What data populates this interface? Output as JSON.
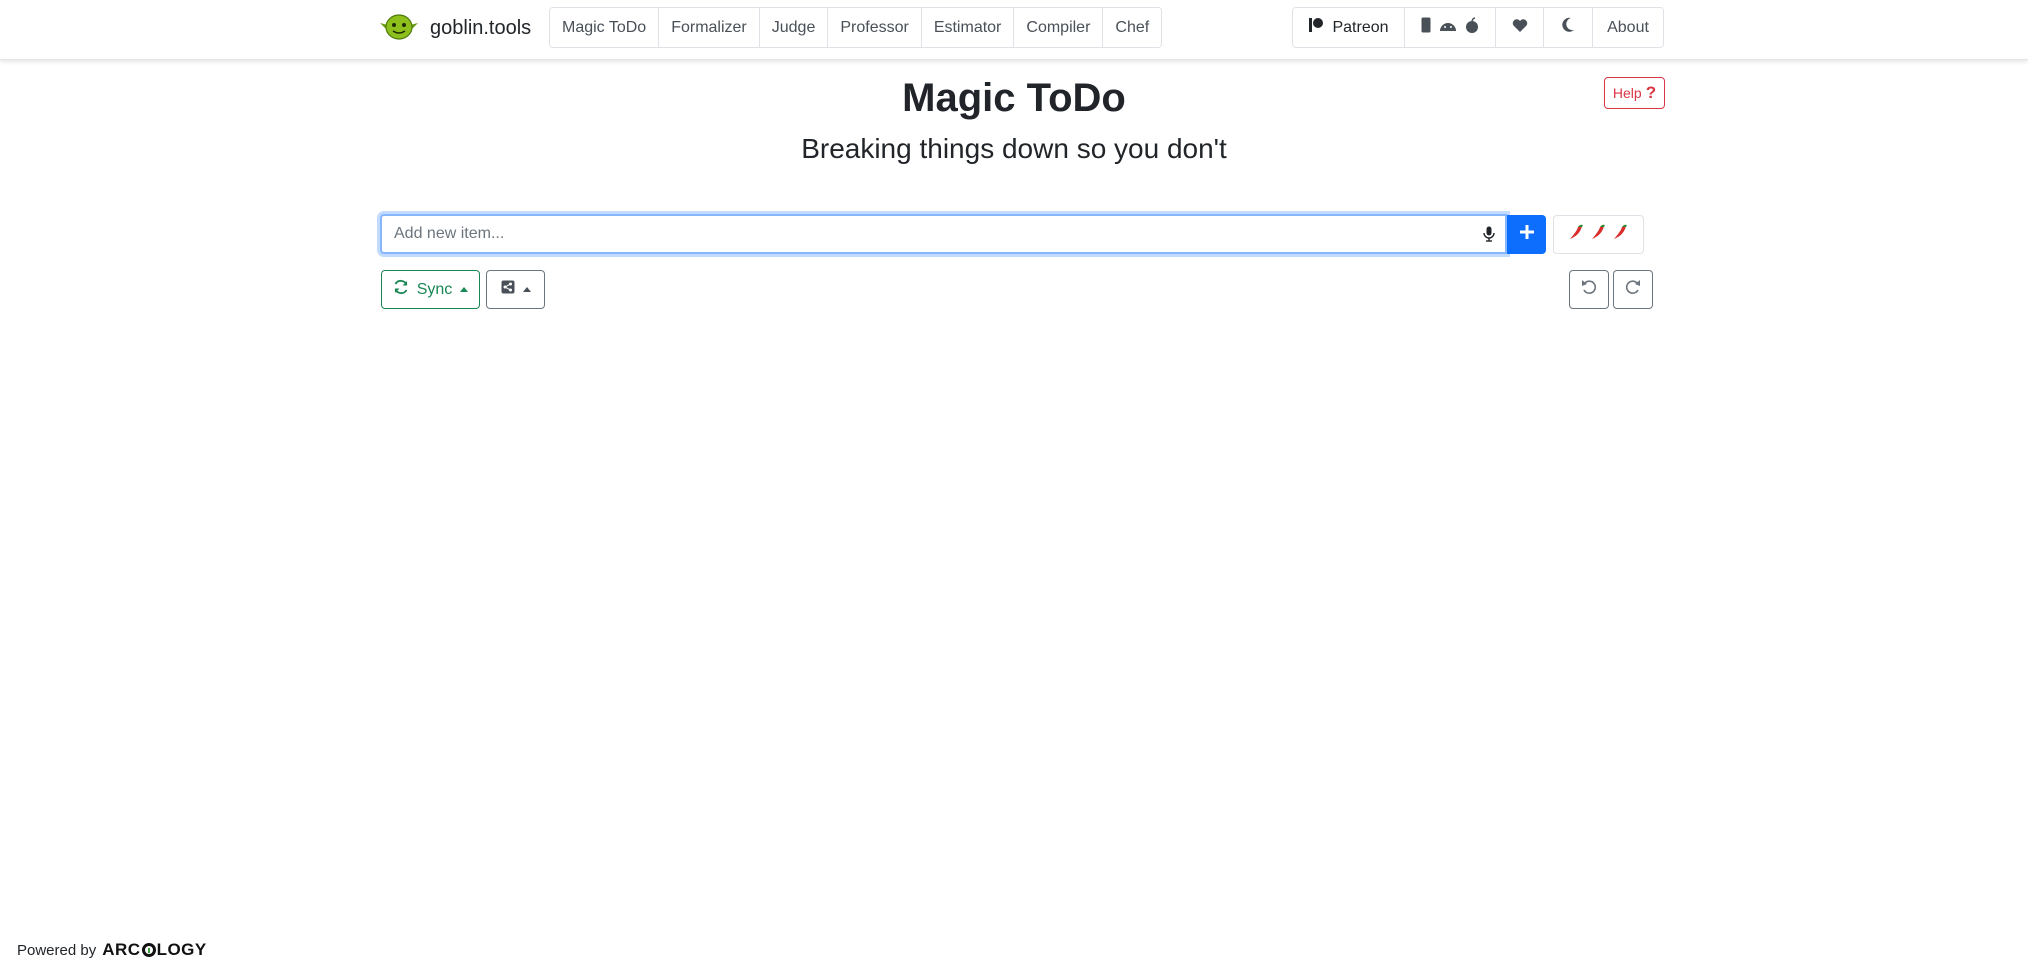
{
  "brand": {
    "name": "goblin.tools",
    "logo_icon": "goblin-face-icon",
    "logo_color": "#8dbf1d"
  },
  "nav": {
    "tools": [
      "Magic ToDo",
      "Formalizer",
      "Judge",
      "Professor",
      "Estimator",
      "Compiler",
      "Chef"
    ],
    "patreon_label": "Patreon",
    "about_label": "About"
  },
  "page": {
    "title": "Magic ToDo",
    "subtitle": "Breaking things down so you don't",
    "help_label": "Help"
  },
  "input": {
    "placeholder": "Add new item..."
  },
  "buttons": {
    "sync_label": "Sync"
  },
  "spiciness": {
    "level": 3,
    "max": 3,
    "icon": "chili-pepper-icon"
  },
  "footer": {
    "powered_by": "Powered by",
    "company_prefix": "ARC",
    "company_suffix": "LOGY"
  },
  "colors": {
    "primary": "#0d6efd",
    "success": "#198754",
    "danger": "#dc3545",
    "focus": "#86b7fe"
  }
}
